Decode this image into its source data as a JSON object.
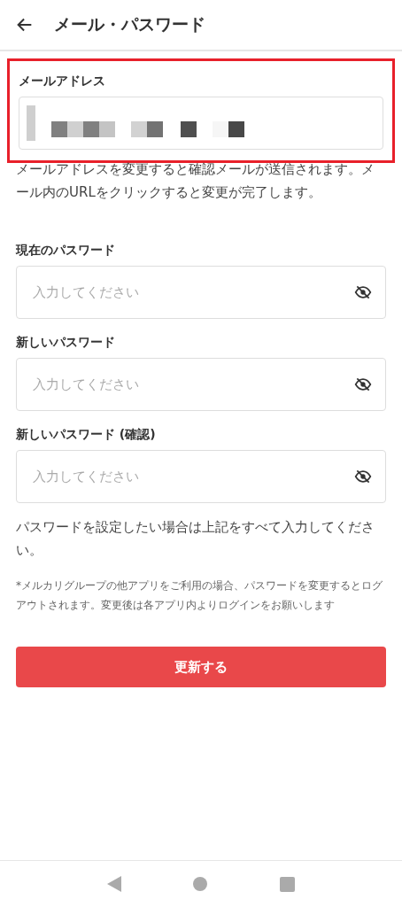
{
  "header": {
    "title": "メール・パスワード"
  },
  "email": {
    "label": "メールアドレス",
    "highlighted": true,
    "redacted": true
  },
  "email_note": "メールアドレスを変更すると確認メールが送信されます。メール内のURLをクリックすると変更が完了します。",
  "password_fields": [
    {
      "label": "現在のパスワード",
      "placeholder": "入力してください"
    },
    {
      "label": "新しいパスワード",
      "placeholder": "入力してください"
    },
    {
      "label": "新しいパスワード (確認)",
      "placeholder": "入力してください"
    }
  ],
  "password_note": "パスワードを設定したい場合は上記をすべて入力してください。",
  "group_note": "*メルカリグループの他アプリをご利用の場合、パスワードを変更するとログアウトされます。変更後は各アプリ内よりログインをお願いします",
  "submit_button": "更新する"
}
